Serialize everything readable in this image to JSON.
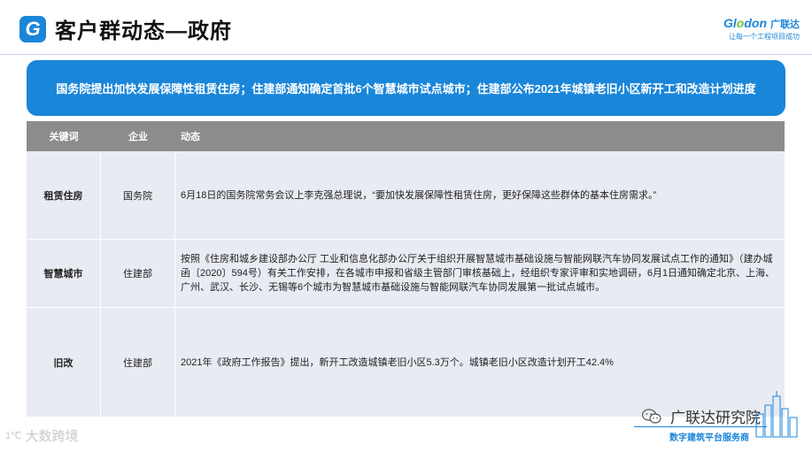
{
  "header": {
    "logo_letter": "G",
    "title": "客户群动态—政府",
    "brand_name_a": "Gl",
    "brand_name_b": "o",
    "brand_name_c": "don",
    "brand_cn": "广联达",
    "brand_slogan": "让每一个工程项目成功"
  },
  "banner": {
    "text": "国务院提出加快发展保障性租赁住房；住建部通知确定首批6个智慧城市试点城市；住建部公布2021年城镇老旧小区新开工和改造计划进度"
  },
  "table": {
    "headers": [
      "关键词",
      "企业",
      "动态"
    ],
    "rows": [
      {
        "keyword": "租赁住房",
        "company": "国务院",
        "news": "6月18日的国务院常务会议上李克强总理说，“要加快发展保障性租赁住房，更好保障这些群体的基本住房需求。”"
      },
      {
        "keyword": "智慧城市",
        "company": "住建部",
        "news": "按照《住房和城乡建设部办公厅 工业和信息化部办公厅关于组织开展智慧城市基础设施与智能网联汽车协同发展试点工作的通知》（建办城函〔2020〕594号）有关工作安排，在各城市申报和省级主管部门审核基础上，经组织专家评审和实地调研，6月1日通知确定北京、上海、广州、武汉、长沙、无锡等6个城市为智慧城市基础设施与智能网联汽车协同发展第一批试点城市。"
      },
      {
        "keyword": "旧改",
        "company": "住建部",
        "news": "2021年《政府工作报告》提出，新开工改造城镇老旧小区5.3万个。城镇老旧小区改造计划开工42.4%"
      }
    ]
  },
  "footer": {
    "wechat_account": "广联达研究院",
    "service_line": "数字建筑平台服务商",
    "watermark": "大数跨境",
    "watermark_mark": "1℃"
  }
}
